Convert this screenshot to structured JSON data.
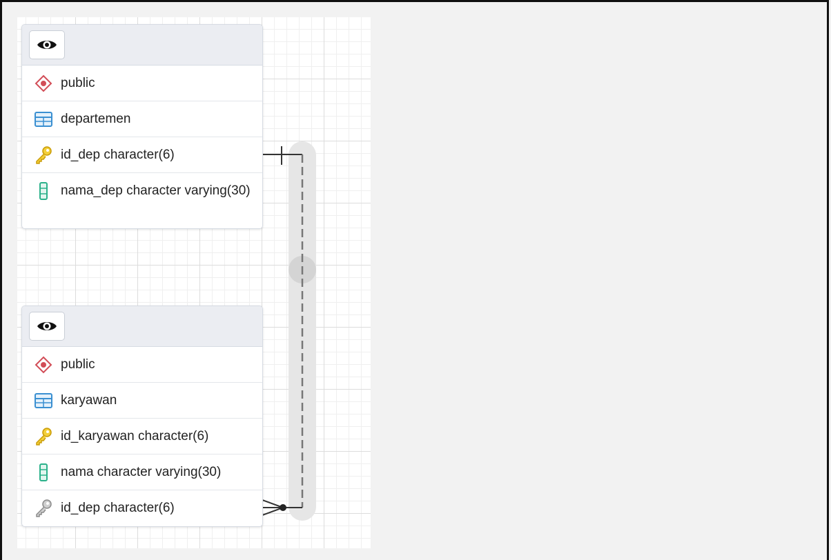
{
  "tables": [
    {
      "schema": "public",
      "name": "departemen",
      "columns": [
        {
          "label": "id_dep character(6)",
          "icon": "primary-key-icon"
        },
        {
          "label": "nama_dep character varying(30)",
          "icon": "column-icon"
        }
      ]
    },
    {
      "schema": "public",
      "name": "karyawan",
      "columns": [
        {
          "label": "id_karyawan character(6)",
          "icon": "primary-key-icon"
        },
        {
          "label": "nama character varying(30)",
          "icon": "column-icon"
        },
        {
          "label": "id_dep character(6)",
          "icon": "foreign-key-icon"
        }
      ]
    }
  ],
  "colors": {
    "schema_icon": "#d24d57",
    "table_icon": "#3a8fd1",
    "key_icon": "#e7b416",
    "fk_icon": "#9a9a9a",
    "column_icon": "#2bb18a"
  }
}
